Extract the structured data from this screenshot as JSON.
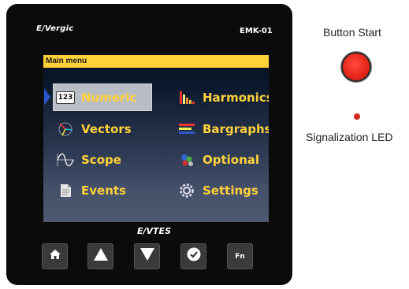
{
  "device": {
    "brand": "E/Vergic",
    "model": "EMK-01",
    "bottom_logo": "E/VTES"
  },
  "screen": {
    "header": "Main menu",
    "menu_items": [
      {
        "label": "Numeric",
        "icon": "numeric-123-icon",
        "icon_text": "123",
        "selected": true
      },
      {
        "label": "Vectors",
        "icon": "vectors-icon",
        "selected": false
      },
      {
        "label": "Scope",
        "icon": "scope-icon",
        "selected": false
      },
      {
        "label": "Events",
        "icon": "events-icon",
        "selected": false
      },
      {
        "label": "Harmonics",
        "icon": "harmonics-icon",
        "selected": false
      },
      {
        "label": "Bargraphs",
        "icon": "bargraphs-icon",
        "selected": false
      },
      {
        "label": "Optional",
        "icon": "optional-icon",
        "selected": false
      },
      {
        "label": "Settings",
        "icon": "settings-icon",
        "selected": false
      }
    ]
  },
  "hardware_buttons": [
    {
      "name": "home",
      "icon": "home-icon"
    },
    {
      "name": "up",
      "icon": "arrow-up-icon"
    },
    {
      "name": "down",
      "icon": "arrow-down-icon"
    },
    {
      "name": "ok",
      "icon": "check-icon"
    },
    {
      "name": "fn",
      "icon": "fn-icon",
      "label": "Fn"
    }
  ],
  "annotations": {
    "button_start": "Button Start",
    "signalization_led": "Signalization LED"
  },
  "colors": {
    "menu_text": "#ffd23a",
    "menu_bar": "#ffd23a",
    "start_button": "#e8271c",
    "led": "#d3281d",
    "selection_arrow": "#2a55c8"
  }
}
